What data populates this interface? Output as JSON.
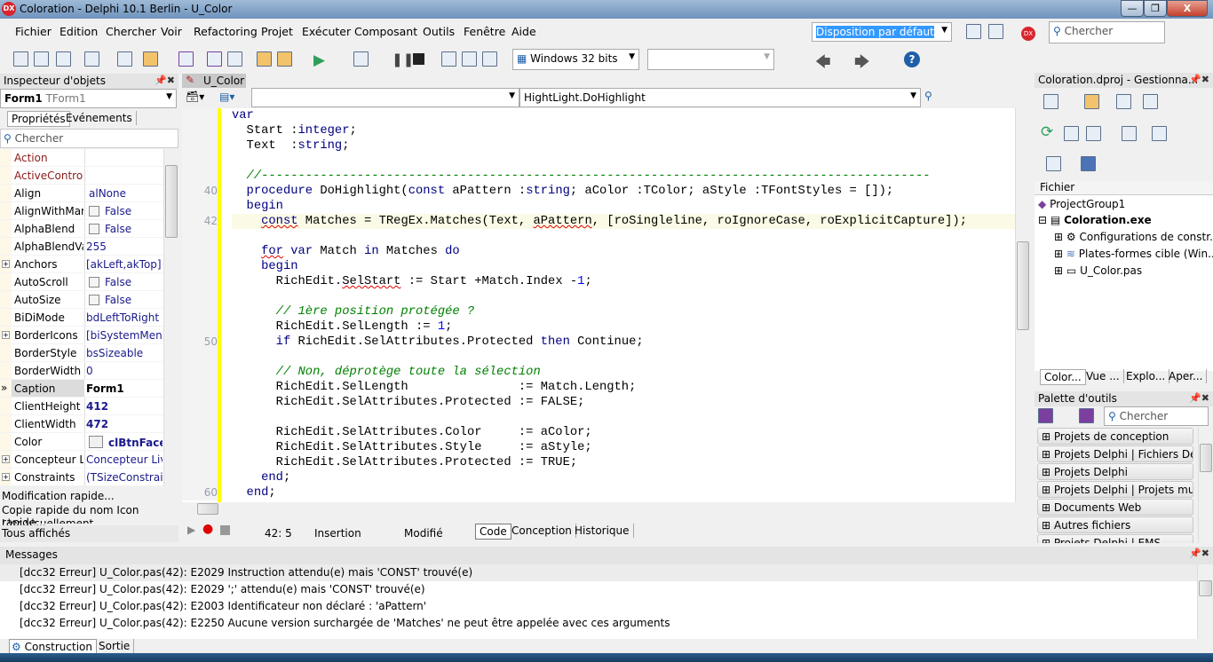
{
  "window": {
    "title": "Coloration - Delphi 10.1 Berlin - U_Color",
    "logo": "DX",
    "minimize": "—",
    "maximize": "❐",
    "close": "X"
  },
  "menu": [
    "Fichier",
    "Edition",
    "Chercher",
    "Voir",
    "Refactoring",
    "Projet",
    "Exécuter",
    "Composant",
    "Outils",
    "Fenêtre",
    "Aide"
  ],
  "layout_combo": "Disposition par défaut",
  "search_placeholder": "Chercher",
  "platform_combo": "Windows 32 bits",
  "inspector": {
    "title": "Inspecteur d'objets",
    "object": "Form1",
    "object_type": "TForm1",
    "tabs": [
      "Propriétés",
      "Evénements"
    ],
    "search": "Chercher",
    "properties": [
      {
        "name": "Action",
        "value": "",
        "ref": true
      },
      {
        "name": "ActiveControl",
        "value": "",
        "ref": true
      },
      {
        "name": "Align",
        "value": "alNone"
      },
      {
        "name": "AlignWithMargins",
        "value": "False",
        "check": true
      },
      {
        "name": "AlphaBlend",
        "value": "False",
        "check": true
      },
      {
        "name": "AlphaBlendValue",
        "value": "255"
      },
      {
        "name": "Anchors",
        "value": "[akLeft,akTop]",
        "expand": true
      },
      {
        "name": "AutoScroll",
        "value": "False",
        "check": true
      },
      {
        "name": "AutoSize",
        "value": "False",
        "check": true
      },
      {
        "name": "BiDiMode",
        "value": "bdLeftToRight"
      },
      {
        "name": "BorderIcons",
        "value": "[biSystemMenu,",
        "expand": true
      },
      {
        "name": "BorderStyle",
        "value": "bsSizeable"
      },
      {
        "name": "BorderWidth",
        "value": "0"
      },
      {
        "name": "Caption",
        "value": "Form1",
        "selected": true
      },
      {
        "name": "ClientHeight",
        "value": "412",
        "bold": true
      },
      {
        "name": "ClientWidth",
        "value": "472",
        "bold": true
      },
      {
        "name": "Color",
        "value": "clBtnFace",
        "bold": true,
        "swatch": "#f0f0f0"
      },
      {
        "name": "Concepteur LiveBindings",
        "value": "Concepteur Live",
        "expand": true
      },
      {
        "name": "Constraints",
        "value": "(TSizeConstraints)",
        "expand": true
      }
    ],
    "actions": [
      "Modification rapide...",
      "Copie rapide du nom  Icon rapide...",
      "Lier visuellement"
    ],
    "filter": "Tous affichés"
  },
  "editor": {
    "tab": "U_Color",
    "method_combo": "HightLight.DoHighlight",
    "lines": [
      {
        "n": "",
        "t": [
          [
            "k",
            "var"
          ]
        ]
      },
      {
        "n": "",
        "t": [
          [
            "i",
            "  Start :"
          ],
          [
            "k",
            "integer"
          ],
          [
            "i",
            ";"
          ]
        ]
      },
      {
        "n": "",
        "t": [
          [
            "i",
            "  Text  :"
          ],
          [
            "k",
            "string"
          ],
          [
            "i",
            ";"
          ]
        ]
      },
      {
        "n": "",
        "t": []
      },
      {
        "n": "",
        "t": [
          [
            "c",
            "  //-------------------------------------------------------------------------------------------"
          ]
        ]
      },
      {
        "n": "40",
        "t": [
          [
            "k",
            "  procedure "
          ],
          [
            "i",
            "DoHighlight("
          ],
          [
            "k",
            "const "
          ],
          [
            "i",
            "aPattern :"
          ],
          [
            "k",
            "string"
          ],
          [
            "i",
            "; aColor :TColor; aStyle :TFontStyles = []);"
          ]
        ]
      },
      {
        "n": "",
        "t": [
          [
            "k",
            "  begin"
          ]
        ]
      },
      {
        "n": "42",
        "t": [
          [
            "i",
            "    "
          ],
          [
            "k sq",
            "const"
          ],
          [
            "i",
            " Matches = TRegEx.Matches(Text, "
          ],
          [
            "i sq",
            "aPattern"
          ],
          [
            "i",
            ", [roSingleline, roIgnoreCase, roExplicitCapture]);"
          ]
        ],
        "current": true
      },
      {
        "n": "",
        "t": []
      },
      {
        "n": "",
        "t": [
          [
            "i",
            "    "
          ],
          [
            "k sq",
            "for"
          ],
          [
            "k",
            " var "
          ],
          [
            "i",
            "Match "
          ],
          [
            "k",
            "in "
          ],
          [
            "i",
            "Matches "
          ],
          [
            "k",
            "do"
          ]
        ]
      },
      {
        "n": "",
        "t": [
          [
            "k",
            "    begin"
          ]
        ]
      },
      {
        "n": "",
        "t": [
          [
            "i",
            "      RichEdit."
          ],
          [
            "i sq",
            "SelStart"
          ],
          [
            "i",
            " := Start +Match.Index -"
          ],
          [
            "n",
            "1"
          ],
          [
            "i",
            ";"
          ]
        ]
      },
      {
        "n": "",
        "t": []
      },
      {
        "n": "",
        "t": [
          [
            "c",
            "      // 1ère position protégée ?"
          ]
        ]
      },
      {
        "n": "",
        "t": [
          [
            "i",
            "      RichEdit.SelLength := "
          ],
          [
            "n",
            "1"
          ],
          [
            "i",
            ";"
          ]
        ]
      },
      {
        "n": "50",
        "t": [
          [
            "k",
            "      if "
          ],
          [
            "i",
            "RichEdit.SelAttributes.Protected "
          ],
          [
            "k",
            "then "
          ],
          [
            "i",
            "Continue;"
          ]
        ]
      },
      {
        "n": "",
        "t": []
      },
      {
        "n": "",
        "t": [
          [
            "c",
            "      // Non, déprotège toute la sélection"
          ]
        ]
      },
      {
        "n": "",
        "t": [
          [
            "i",
            "      RichEdit.SelLength               := Match.Length;"
          ]
        ]
      },
      {
        "n": "",
        "t": [
          [
            "i",
            "      RichEdit.SelAttributes.Protected := FALSE;"
          ]
        ]
      },
      {
        "n": "",
        "t": []
      },
      {
        "n": "",
        "t": [
          [
            "i",
            "      RichEdit.SelAttributes.Color     := aColor;"
          ]
        ]
      },
      {
        "n": "",
        "t": [
          [
            "i",
            "      RichEdit.SelAttributes.Style     := aStyle;"
          ]
        ]
      },
      {
        "n": "",
        "t": [
          [
            "i",
            "      RichEdit.SelAttributes.Protected := TRUE;"
          ]
        ]
      },
      {
        "n": "",
        "t": [
          [
            "k",
            "    end"
          ],
          [
            "i",
            ";"
          ]
        ]
      },
      {
        "n": "60",
        "t": [
          [
            "k",
            "  end"
          ],
          [
            "i",
            ";"
          ]
        ]
      }
    ],
    "status": {
      "position": "42:  5",
      "mode": "Insertion",
      "state": "Modifié"
    },
    "view_tabs": [
      "Code",
      "Conception",
      "Historique"
    ]
  },
  "project": {
    "title": "Coloration.dproj - Gestionna...",
    "column": "Fichier",
    "tree": [
      "ProjectGroup1",
      "Coloration.exe",
      "Configurations de constr...",
      "Plates-formes cible (Win...",
      "U_Color.pas"
    ],
    "tabs": [
      "Color...",
      "Vue ...",
      "Explo...",
      "Aper..."
    ]
  },
  "palette": {
    "title": "Palette d'outils",
    "search": "Chercher",
    "categories": [
      "Projets de conception",
      "Projets Delphi | Fichiers Delphi",
      "Projets Delphi",
      "Projets Delphi | Projets multi-...",
      "Documents Web",
      "Autres fichiers",
      "Projets Delphi | EMS"
    ]
  },
  "messages": {
    "title": "Messages",
    "items": [
      "[dcc32 Erreur] U_Color.pas(42): E2029 Instruction attendu(e) mais 'CONST' trouvé(e)",
      "[dcc32 Erreur] U_Color.pas(42): E2029 ';' attendu(e) mais 'CONST' trouvé(e)",
      "[dcc32 Erreur] U_Color.pas(42): E2003 Identificateur non déclaré : 'aPattern'",
      "[dcc32 Erreur] U_Color.pas(42): E2250 Aucune version surchargée de 'Matches' ne peut être appelée avec ces arguments"
    ],
    "tabs": [
      "Construction",
      "Sortie"
    ]
  },
  "colors": {
    "accent": "#3399ff",
    "keyword": "#000080",
    "comment": "#008000",
    "number": "#0000ff",
    "modified_bar": "#ffff00",
    "current_line": "#fafae6"
  }
}
